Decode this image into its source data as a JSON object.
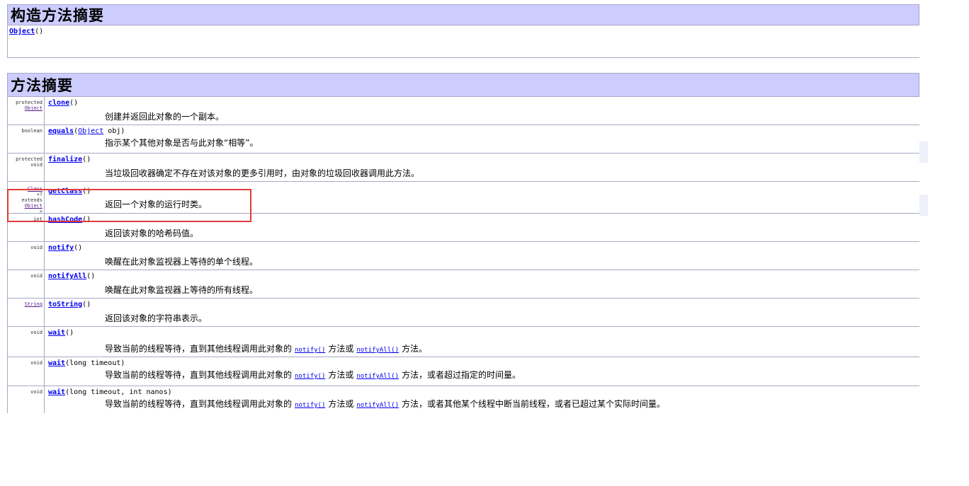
{
  "constructor_summary": {
    "title": "构造方法摘要",
    "constructor": {
      "name": "Object",
      "params": "()"
    }
  },
  "method_summary": {
    "title": "方法摘要",
    "methods": [
      {
        "modifier": [
          "protected"
        ],
        "type_link": "Object",
        "type_rest": "",
        "name": "clone",
        "params": "()",
        "desc": "创建并返回此对象的一个副本。"
      },
      {
        "modifier": [
          "boolean"
        ],
        "type_link": "",
        "type_rest": "",
        "name": "equals",
        "params_pre": "(",
        "param_link": "Object",
        "params": " obj)",
        "desc": "指示某个其他对象是否与此对象“相等”。"
      },
      {
        "modifier": [
          "protected",
          "void"
        ],
        "type_link": "",
        "type_rest": "",
        "name": "finalize",
        "params": "()",
        "desc": "当垃圾回收器确定不存在对该对象的更多引用时，由对象的垃圾回收器调用此方法。"
      },
      {
        "modifier": [],
        "type_link": "Class",
        "type_rest": "<?",
        "type_extra": "extends",
        "type_link2": "Object",
        "type_rest2": ">",
        "name": "getClass",
        "params": "()",
        "desc": "返回一个对象的运行时类。"
      },
      {
        "modifier": [
          "int"
        ],
        "type_link": "",
        "name": "hashCode",
        "params": "()",
        "desc": "返回该对象的哈希码值。"
      },
      {
        "modifier": [
          "void"
        ],
        "type_link": "",
        "name": "notify",
        "params": "()",
        "desc": "唤醒在此对象监视器上等待的单个线程。"
      },
      {
        "modifier": [
          "void"
        ],
        "type_link": "",
        "name": "notifyAll",
        "params": "()",
        "desc": "唤醒在此对象监视器上等待的所有线程。"
      },
      {
        "modifier": [],
        "type_link": "String",
        "name": "toString",
        "params": "()",
        "desc": "返回该对象的字符串表示。"
      },
      {
        "modifier": [
          "void"
        ],
        "type_link": "",
        "name": "wait",
        "params": "()",
        "desc_a": "导致当前的线程等待，直到其他线程调用此对象的",
        "link_a": "notify()",
        "desc_b": "方法或",
        "link_b": "notifyAll()",
        "desc_c": "方法。"
      },
      {
        "modifier": [
          "void"
        ],
        "type_link": "",
        "name": "wait",
        "params": "(long timeout)",
        "desc_a": "导致当前的线程等待，直到其他线程调用此对象的",
        "link_a": "notify()",
        "desc_b": "方法或",
        "link_b": "notifyAll()",
        "desc_c": "方法，或者超过指定的时间量。"
      },
      {
        "modifier": [
          "void"
        ],
        "type_link": "",
        "name": "wait",
        "params": "(long timeout, int nanos)",
        "desc_a": "导致当前的线程等待，直到其他线程调用此对象的",
        "link_a": "notify()",
        "desc_b": "方法或",
        "link_b": "notifyAll()",
        "desc_c": "方法，或者其他某个线程中断当前线程，或者已超过某个实际时间量。"
      }
    ]
  }
}
